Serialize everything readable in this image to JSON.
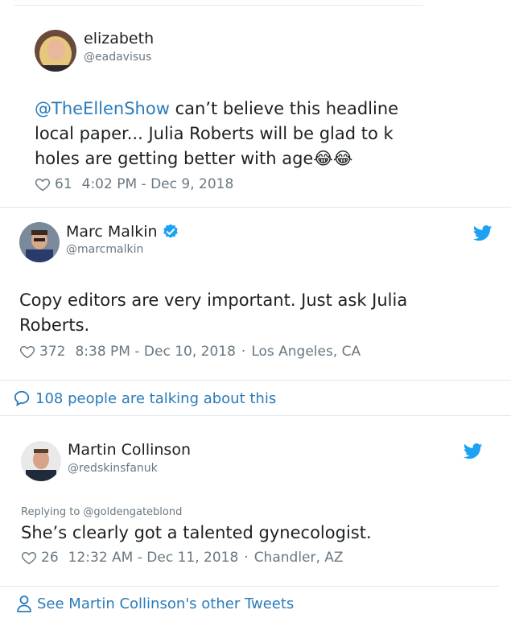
{
  "tweet1": {
    "name": "elizabeth",
    "handle": "@eadavisus",
    "mention": "@TheEllenShow",
    "line1_rest": " can’t believe this headline",
    "line2": "local paper... Julia Roberts will be glad to k",
    "line3": "holes are getting better with age",
    "emoji": "😂😂",
    "likes": "61",
    "timestamp": "4:02 PM - Dec 9, 2018"
  },
  "tweet2": {
    "name": "Marc Malkin",
    "handle": "@marcmalkin",
    "line1": "Copy editors are very important. Just ask Julia",
    "line2": "Roberts.",
    "likes": "372",
    "timestamp": "8:38 PM - Dec 10, 2018",
    "location": "Los Angeles, CA"
  },
  "conversation": {
    "label": "108 people are talking about this"
  },
  "tweet3": {
    "name": "Martin Collinson",
    "handle": "@redskinsfanuk",
    "replying_to": "Replying to @goldengateblond",
    "text": "She’s clearly got a talented gynecologist.",
    "likes": "26",
    "timestamp": "12:32 AM - Dec 11, 2018",
    "location": "Chandler, AZ"
  },
  "footer": {
    "label": "See Martin Collinson's other Tweets"
  },
  "colors": {
    "accent": "#2b7bb9",
    "twitter_blue": "#1da1f2",
    "muted": "#697882",
    "text": "#1c2022"
  },
  "icons": [
    "heart-icon",
    "twitter-bird-icon",
    "verified-badge-icon",
    "comment-bubble-icon",
    "person-icon"
  ]
}
